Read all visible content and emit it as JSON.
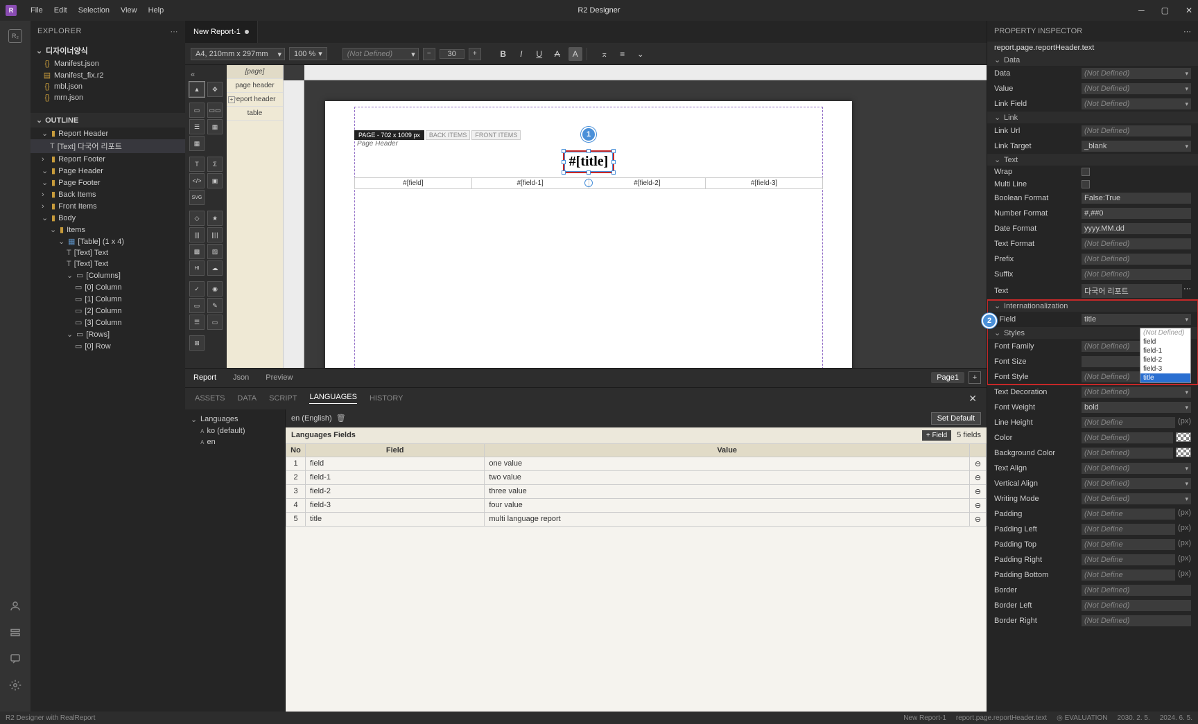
{
  "menubar": {
    "file": "File",
    "edit": "Edit",
    "selection": "Selection",
    "view": "View",
    "help": "Help"
  },
  "app_title": "R2 Designer",
  "explorer": {
    "title": "EXPLORER",
    "project": "디자이너양식",
    "files": [
      "Manifest.json",
      "Manifest_fix.r2",
      "mbl.json",
      "mrn.json"
    ]
  },
  "outline": {
    "title": "OUTLINE",
    "nodes": [
      {
        "l": "Report Header",
        "d": 1,
        "type": "section",
        "open": true
      },
      {
        "l": "[Text] 다국어 리포트",
        "d": 2,
        "type": "text",
        "sel": true
      },
      {
        "l": "Report Footer",
        "d": 1,
        "type": "section"
      },
      {
        "l": "Page Header",
        "d": 1,
        "type": "section",
        "open": true
      },
      {
        "l": "Page Footer",
        "d": 1,
        "type": "section",
        "open": true
      },
      {
        "l": "Back Items",
        "d": 1,
        "type": "section"
      },
      {
        "l": "Front Items",
        "d": 1,
        "type": "section"
      },
      {
        "l": "Body",
        "d": 1,
        "type": "section",
        "open": true
      },
      {
        "l": "Items",
        "d": 2,
        "type": "section",
        "open": true
      },
      {
        "l": "[Table] (1 x 4)",
        "d": 3,
        "type": "table",
        "open": true
      },
      {
        "l": "[Text] Text",
        "d": 4,
        "type": "text"
      },
      {
        "l": "[Text] Text",
        "d": 4,
        "type": "text"
      },
      {
        "l": "[Columns]",
        "d": 4,
        "type": "cols",
        "open": true
      },
      {
        "l": "[0] Column",
        "d": 5,
        "type": "col"
      },
      {
        "l": "[1] Column",
        "d": 5,
        "type": "col"
      },
      {
        "l": "[2] Column",
        "d": 5,
        "type": "col"
      },
      {
        "l": "[3] Column",
        "d": 5,
        "type": "col"
      },
      {
        "l": "[Rows]",
        "d": 4,
        "type": "rows",
        "open": true
      },
      {
        "l": "[0] Row",
        "d": 5,
        "type": "row"
      }
    ]
  },
  "tabs": {
    "open": "New Report-1"
  },
  "toolbar": {
    "pagesize": "A4, 210mm x 297mm",
    "zoom": "100 %",
    "tag": "(Not Defined)",
    "fontsize": "30"
  },
  "struct": [
    "[page]",
    "page header",
    "report header",
    "table"
  ],
  "canvas": {
    "page_tag": "PAGE - 702 x 1009 px",
    "back": "BACK ITEMS",
    "front": "FRONT ITEMS",
    "ph": "Page Header",
    "title": "#[title]",
    "fields": [
      "#[field]",
      "#[field-1]",
      "#[field-2]",
      "#[field-3]"
    ]
  },
  "bottom": {
    "report": "Report",
    "json": "Json",
    "preview": "Preview",
    "page": "Page1"
  },
  "subtabs": {
    "assets": "ASSETS",
    "data": "DATA",
    "script": "SCRIPT",
    "languages": "LANGUAGES",
    "history": "HISTORY"
  },
  "lang": {
    "root": "Languages",
    "nodes": [
      "ko (default)",
      "en"
    ],
    "current": "en (English)",
    "setdef": "Set Default",
    "fields_title": "Languages Fields",
    "addfield": "+ Field",
    "count": "5 fields",
    "head": {
      "no": "No",
      "field": "Field",
      "value": "Value"
    },
    "rows": [
      {
        "no": "1",
        "field": "field",
        "value": "one value"
      },
      {
        "no": "2",
        "field": "field-1",
        "value": "two value"
      },
      {
        "no": "3",
        "field": "field-2",
        "value": "three value"
      },
      {
        "no": "4",
        "field": "field-3",
        "value": "four value"
      },
      {
        "no": "5",
        "field": "title",
        "value": "multi language report"
      }
    ]
  },
  "inspector": {
    "title": "PROPERTY INSPECTOR",
    "path": "report.page.reportHeader.text",
    "groups": {
      "data": "Data",
      "link": "Link",
      "text_g": "Text",
      "intl": "Internationalization",
      "styles": "Styles"
    },
    "labels": {
      "data": "Data",
      "value": "Value",
      "linkfield": "Link Field",
      "linkurl": "Link Url",
      "linktarget": "Link Target",
      "wrap": "Wrap",
      "multiline": "Multi Line",
      "boolformat": "Boolean Format",
      "numformat": "Number Format",
      "dateformat": "Date Format",
      "textformat": "Text Format",
      "prefix": "Prefix",
      "suffix": "Suffix",
      "text": "Text",
      "field": "* Field",
      "fontfamily": "Font Family",
      "fontsize": "Font Size",
      "fontstyle": "Font Style",
      "textdeco": "Text Decoration",
      "fontweight": "Font Weight",
      "lineheight": "Line Height",
      "color": "Color",
      "bgcolor": "Background Color",
      "textalign": "Text Align",
      "valign": "Vertical Align",
      "writemode": "Writing Mode",
      "padding": "Padding",
      "padleft": "Padding Left",
      "padtop": "Padding Top",
      "padright": "Padding Right",
      "padbottom": "Padding Bottom",
      "border": "Border",
      "borderleft": "Border Left",
      "borderright": "Border Right"
    },
    "values": {
      "notdef": "(Not Defined)",
      "blank": "_blank",
      "boolf": "False:True",
      "numf": "#,##0",
      "datef": "yyyy.MM.dd",
      "text_v": "다국어 리포트",
      "field_v": "title",
      "fontsize_v": "30",
      "px": "(px)",
      "bold": "bold"
    },
    "dropdown": [
      "(Not Defined)",
      "field",
      "field-1",
      "field-2",
      "field-3",
      "title"
    ]
  },
  "status": {
    "left": "R2 Designer with RealReport",
    "doc": "New Report-1",
    "sel": "report.page.reportHeader.text",
    "eval": "◎ EVALUATION",
    "d1": "2030. 2. 5.",
    "d2": "2024. 6. 5."
  },
  "annot": {
    "a1": "1",
    "a2": "2"
  }
}
